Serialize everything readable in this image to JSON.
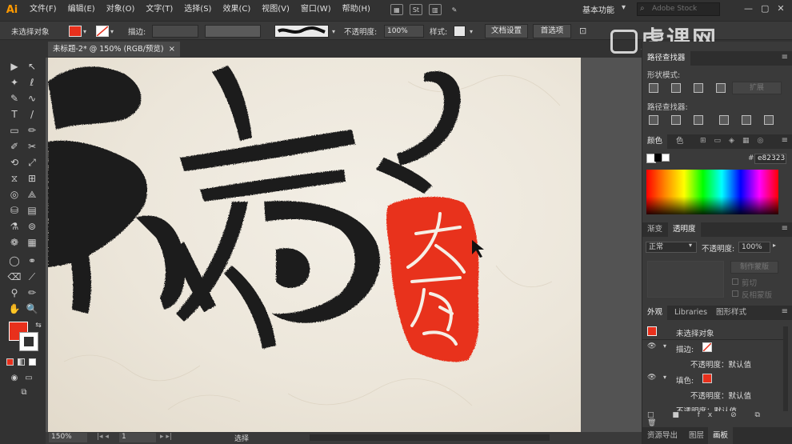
{
  "app": {
    "logo": "Ai"
  },
  "menu": [
    "文件(F)",
    "编辑(E)",
    "对象(O)",
    "文字(T)",
    "选择(S)",
    "效果(C)",
    "视图(V)",
    "窗口(W)",
    "帮助(H)"
  ],
  "menubar": {
    "st_icon": "St",
    "workspace_label": "基本功能",
    "search_placeholder": "Adobe Stock",
    "window_controls": [
      "—",
      "▢",
      "✕"
    ]
  },
  "controlbar": {
    "selection_label": "未选择对象",
    "stroke_label": "描边:",
    "opacity_label": "不透明度:",
    "opacity_value": "100%",
    "style_label": "样式:",
    "doc_setup_button": "文档设置",
    "preferences_button": "首选项"
  },
  "document_tab": {
    "title": "未标题-2* @ 150% (RGB/预览)",
    "close": "×"
  },
  "tools": [
    "▶",
    "↖",
    "✎",
    "T",
    "/",
    "▭",
    "✏",
    "✂",
    "⟲",
    "⤢",
    "⊞",
    "◎",
    "⛁",
    "▤",
    "⚗",
    "▦",
    "✋",
    "🔍"
  ],
  "artwork": {
    "fill_color": "#e8301c",
    "ink_color": "#1e1e1e",
    "paper_color": "#ede7dc"
  },
  "statusbar": {
    "zoom": "150%",
    "artboard_number": "1",
    "mode": "选择"
  },
  "watermark": {
    "text": "虎课网"
  },
  "pathfinder": {
    "tab": "路径查找器",
    "shape_modes_label": "形状模式:",
    "expand_button": "扩展",
    "pathfinders_label": "路径查找器:"
  },
  "color_panel": {
    "tabs": [
      "颜色",
      "色"
    ],
    "hex_value": "e82323"
  },
  "transparency_panel": {
    "tabs": [
      "渐变",
      "透明度"
    ],
    "blend_mode": "正常",
    "opacity_label": "不透明度:",
    "opacity_value": "100%",
    "make_mask_button": "制作蒙版",
    "clip_label": "剪切",
    "invert_mask_label": "反相蒙版"
  },
  "appearance_panel": {
    "tabs": [
      "外观",
      "Libraries",
      "图形样式"
    ],
    "title_row": "未选择对象",
    "rows": [
      {
        "label": "描边:",
        "kind": "stroke"
      },
      {
        "label": "不透明度：默认值",
        "kind": "sub"
      },
      {
        "label": "填色:",
        "kind": "fill"
      },
      {
        "label": "不透明度：默认值",
        "kind": "sub"
      },
      {
        "label": "不透明度：默认值",
        "kind": "plain"
      }
    ]
  },
  "bottom_tabs": [
    "资源导出",
    "图层",
    "画板"
  ]
}
